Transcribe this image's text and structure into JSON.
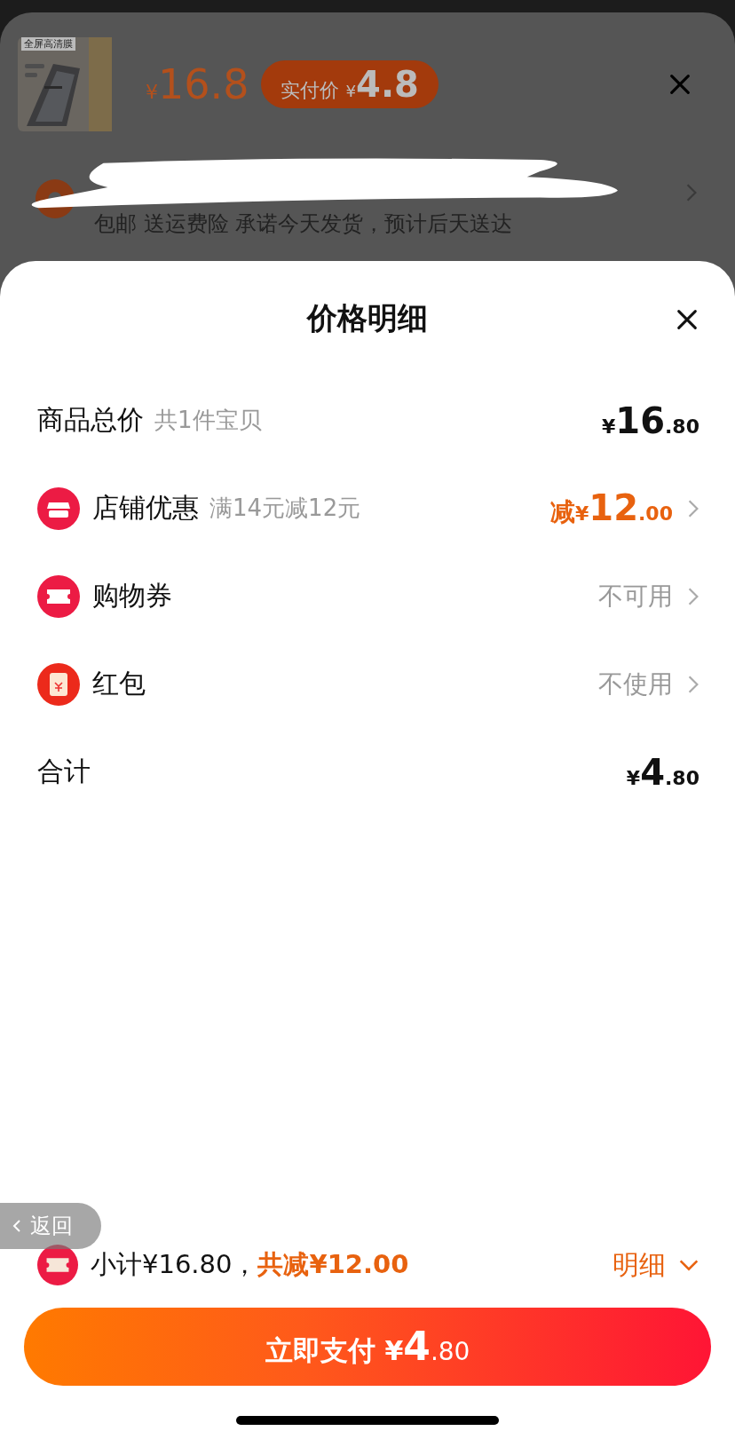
{
  "product_sheet": {
    "thumbnail": {
      "kind": "picture",
      "badge": "全屏高清膜"
    },
    "price": {
      "currency": "¥",
      "amount": "16.8"
    },
    "pay_price_pill": {
      "label": "实付价",
      "currency": "¥",
      "amount": "4.8"
    },
    "shipping_note": "包邮 送运费险 承诺今天发货，预计后天送达"
  },
  "price_detail": {
    "title": "价格明细",
    "rows": [
      {
        "kind": "amount",
        "label": "商品总价",
        "note": "共1件宝贝",
        "value": {
          "currency": "¥",
          "integer": "16",
          "decimal": ".80"
        }
      },
      {
        "kind": "discount",
        "label": "店铺优惠",
        "note": "满14元减12元",
        "value": {
          "prefix": "减",
          "currency": "¥",
          "integer": "12",
          "decimal": ".00"
        }
      },
      {
        "kind": "option",
        "label": "购物券",
        "status": "不可用"
      },
      {
        "kind": "option",
        "label": "红包",
        "status": "不使用"
      },
      {
        "kind": "amount",
        "label": "合计",
        "value": {
          "currency": "¥",
          "integer": "4",
          "decimal": ".80"
        }
      }
    ]
  },
  "back_button": {
    "label": "返回"
  },
  "summary": {
    "subtotal": "小计¥16.80，",
    "saving": "共减¥12.00",
    "detail_toggle": "明细",
    "expanded": true
  },
  "pay_button": {
    "label": "立即支付",
    "currency": "¥",
    "integer": "4",
    "decimal": ".80"
  }
}
